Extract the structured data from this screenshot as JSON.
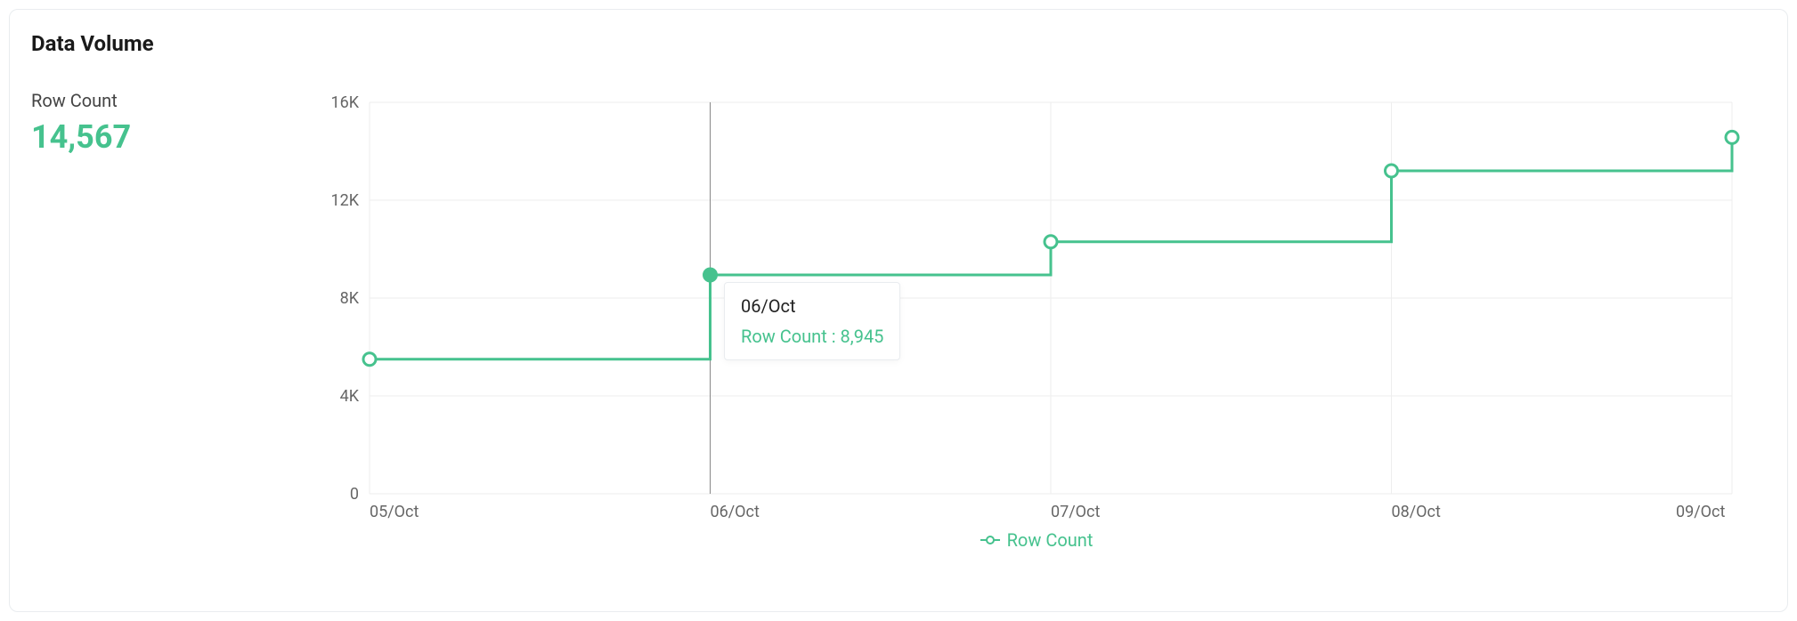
{
  "header": {
    "title": "Data Volume"
  },
  "stat": {
    "label": "Row Count",
    "value": "14,567"
  },
  "yticks": {
    "t0": "0",
    "t1": "4K",
    "t2": "8K",
    "t3": "12K",
    "t4": "16K"
  },
  "xticks": {
    "t0": "05/Oct",
    "t1": "06/Oct",
    "t2": "07/Oct",
    "t3": "08/Oct",
    "t4": "09/Oct"
  },
  "tooltip": {
    "date": "06/Oct",
    "value": "Row Count : 8,945"
  },
  "legend": {
    "label": "Row Count"
  },
  "colors": {
    "accent": "#46c28e"
  },
  "chart_data": {
    "type": "line",
    "step": "hv",
    "title": "Data Volume",
    "xlabel": "",
    "ylabel": "",
    "ylim": [
      0,
      16000
    ],
    "categories": [
      "05/Oct",
      "06/Oct",
      "07/Oct",
      "08/Oct",
      "09/Oct"
    ],
    "series": [
      {
        "name": "Row Count",
        "values": [
          5500,
          8945,
          10300,
          13200,
          14567
        ]
      }
    ],
    "highlight": {
      "category": "06/Oct",
      "value": 8945
    }
  }
}
